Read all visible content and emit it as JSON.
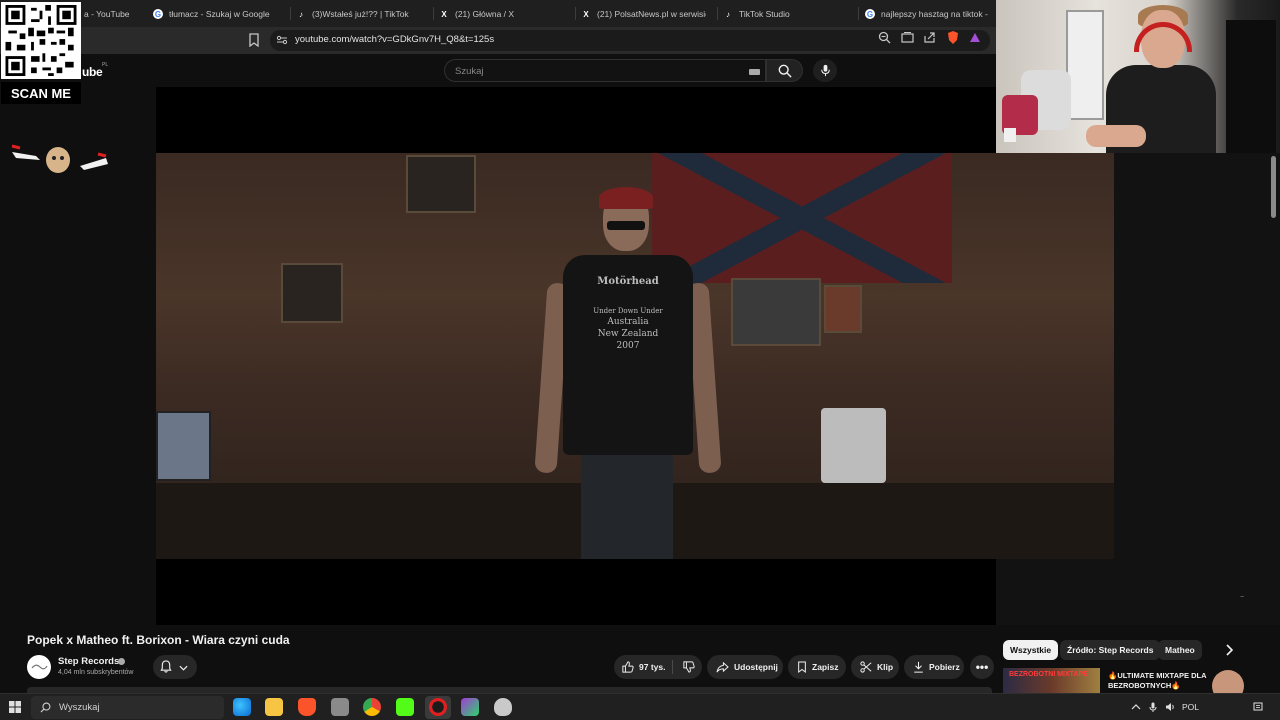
{
  "browser": {
    "tabs": [
      {
        "title": "a - YouTube",
        "icon": "youtube-icon"
      },
      {
        "title": "tłumacz - Szukaj w Google",
        "icon": "google-icon"
      },
      {
        "title": "(3)Wstałeś już!?? | TikTok",
        "icon": "tiktok-icon"
      },
      {
        "title": "(21) Główna / X",
        "icon": "x-icon"
      },
      {
        "title": "(21) PolsatNews.pl w serwisie X",
        "icon": "x-icon"
      },
      {
        "title": "TikTok Studio",
        "icon": "tiktok-icon"
      },
      {
        "title": "najlepszy hasztag na tiktok - ",
        "icon": "google-icon"
      }
    ],
    "url": "youtube.com/watch?v=GDkGnv7H_Q8&t=125s"
  },
  "youtube": {
    "logo_text": "ube",
    "logo_region": "PL",
    "search_placeholder": "Szukaj"
  },
  "overlay": {
    "scan_me": "SCAN ME"
  },
  "video": {
    "shirt_lines": [
      "Motörhead",
      "Under Down Under",
      "Australia",
      "New Zealand",
      "2007"
    ],
    "title": "Popek x Matheo ft. Borixon - Wiara czyni cuda",
    "channel_name": "Step Records",
    "subscribers": "4,04 mln subskrybentów",
    "likes": "97 tys.",
    "share_label": "Udostępnij",
    "save_label": "Zapisz",
    "clip_label": "Klip",
    "download_label": "Pobierz",
    "more_label": "•••"
  },
  "chips": [
    "Wszystkie",
    "Źródło: Step Records",
    "Matheo"
  ],
  "recommendation": {
    "thumb_text": "BEZROBOTNI MIXTAPE",
    "title": "🔥ULTIMATE MIXTAPE DLA BEZROBOTNYCH🔥"
  },
  "taskbar": {
    "search_placeholder": "Wyszukaj",
    "language": "POL"
  },
  "colors": {
    "page_background": "#0f0f0f",
    "chip_active": "#f1f1f1",
    "pill_background": "#272727",
    "headset_red": "#c42020"
  }
}
